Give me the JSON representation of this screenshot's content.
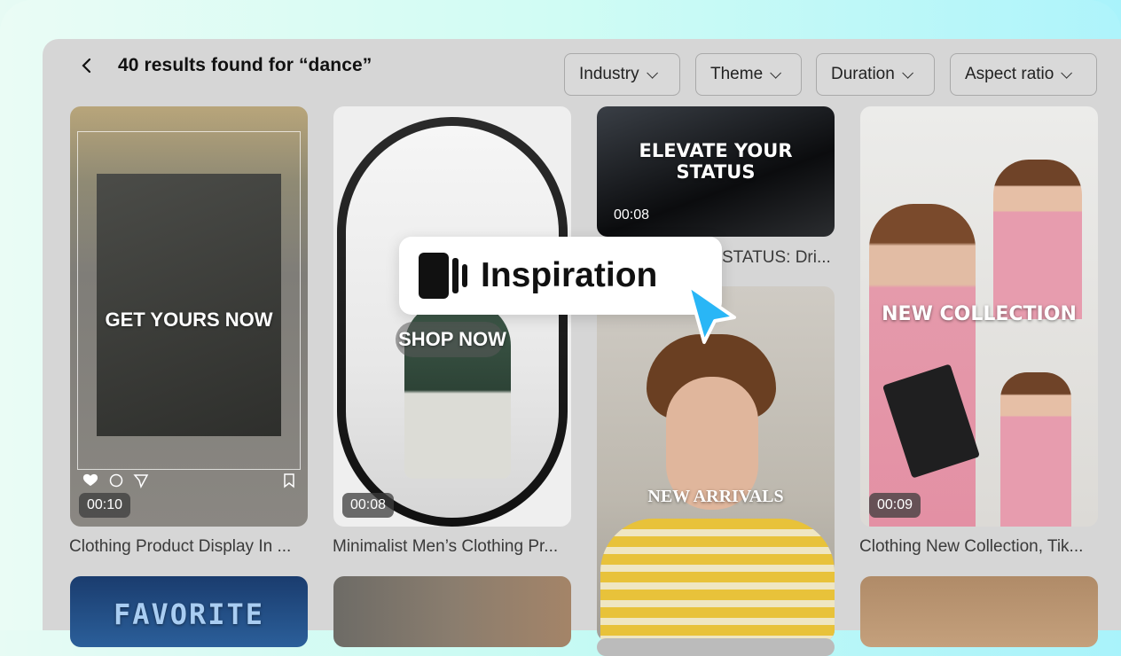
{
  "header": {
    "back_icon": "chevron-left-icon",
    "title": "40 results found for “dance”"
  },
  "filters": [
    {
      "label": "Industry"
    },
    {
      "label": "Theme"
    },
    {
      "label": "Duration"
    },
    {
      "label": "Aspect ratio"
    }
  ],
  "cards": [
    {
      "overlay": "GET YOURS NOW",
      "duration": "00:10",
      "caption": "Clothing Product Display In ..."
    },
    {
      "overlay": "SHOP NOW",
      "duration": "00:08",
      "caption": "Minimalist Men’s Clothing Pr..."
    },
    {
      "overlay": "ELEVATE YOUR STATUS",
      "duration": "00:08",
      "caption": "STATUS: Dri..."
    },
    {
      "overlay": "NEW ARRIVALS"
    },
    {
      "overlay": "NEW COLLECTION",
      "duration": "00:09",
      "caption": "Clothing New Collection, Tik..."
    },
    {
      "overlay": "FAVORITE"
    }
  ],
  "callout": {
    "label": "Inspiration",
    "icon": "video-clip-icon"
  },
  "colors": {
    "accent_cursor": "#29b6f6",
    "panel_bg": "#d6d6d6"
  }
}
